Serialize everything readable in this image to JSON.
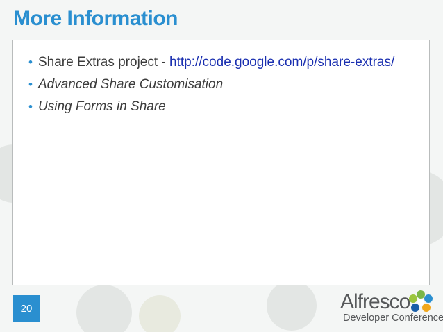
{
  "slide": {
    "title": "More Information",
    "bullets": [
      {
        "prefix": "Share Extras project - ",
        "link": "http://code.google.com/p/share-extras/",
        "style": "normal"
      },
      {
        "text": "Advanced Share Customisation",
        "style": "italic"
      },
      {
        "text": "Using Forms in Share",
        "style": "italic"
      }
    ],
    "page_number": "20"
  },
  "branding": {
    "name": "Alfresco",
    "subtitle": "Developer Conference"
  },
  "colors": {
    "accent": "#2a8fd0",
    "link": "#1a2fb0",
    "text": "#3b3b3b"
  },
  "icons": {
    "bullet": "•"
  }
}
